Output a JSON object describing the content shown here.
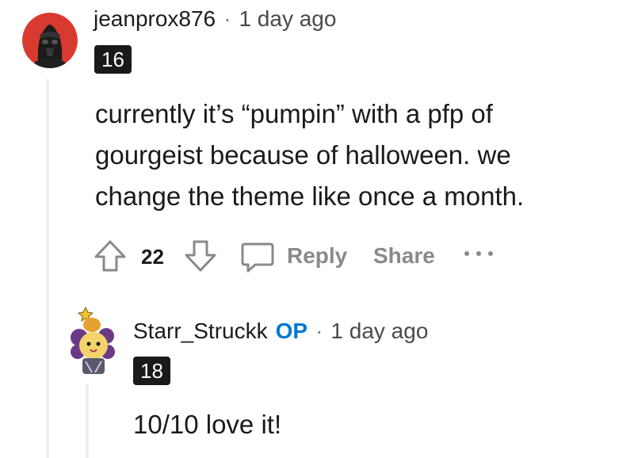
{
  "comments": [
    {
      "username": "jeanprox876",
      "separator": "·",
      "time": "1 day ago",
      "flair": "16",
      "body_lines": [
        "currently it’s “pumpin” with a pfp of",
        "gourgeist because of halloween. we",
        "change the theme like once a month."
      ],
      "actions": {
        "upvotes": "22",
        "reply_label": "Reply",
        "share_label": "Share",
        "more_label": "···"
      },
      "avatar_icon": "darth-vader-avatar"
    },
    {
      "username": "Starr_Struckk",
      "op_badge": "OP",
      "separator": "·",
      "time": "1 day ago",
      "flair": "18",
      "body_lines": [
        "10/10 love it!"
      ],
      "avatar_icon": "cartoon-character-avatar"
    }
  ],
  "colors": {
    "op_badge": "#0079d3",
    "flair_bg": "#1a1a1b",
    "thread_line": "#edeff1",
    "action_label": "#878a8c"
  }
}
